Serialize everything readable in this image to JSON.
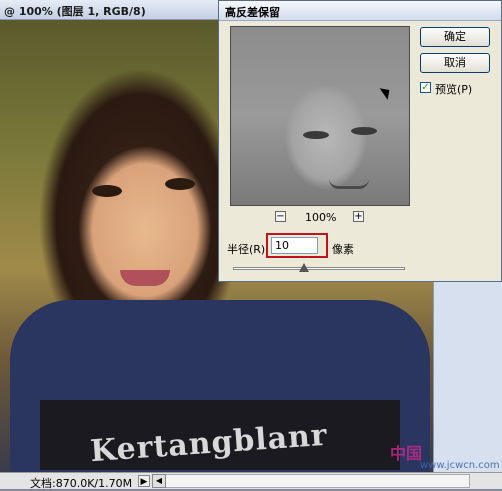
{
  "document": {
    "title": "@ 100% (图层 1, RGB/8)",
    "status_info": "文档:870.0K/1.70M",
    "shirt_text": "Kertangblanr"
  },
  "dialog": {
    "title": "高反差保留",
    "ok_label": "确定",
    "cancel_label": "取消",
    "preview_label": "预览(P)",
    "preview_checked": true,
    "zoom_level": "100%",
    "radius_label": "半径(R):",
    "radius_value": "10",
    "radius_unit": "像素"
  },
  "watermark": {
    "text": "中国",
    "url": "www.jcwcn.com"
  }
}
